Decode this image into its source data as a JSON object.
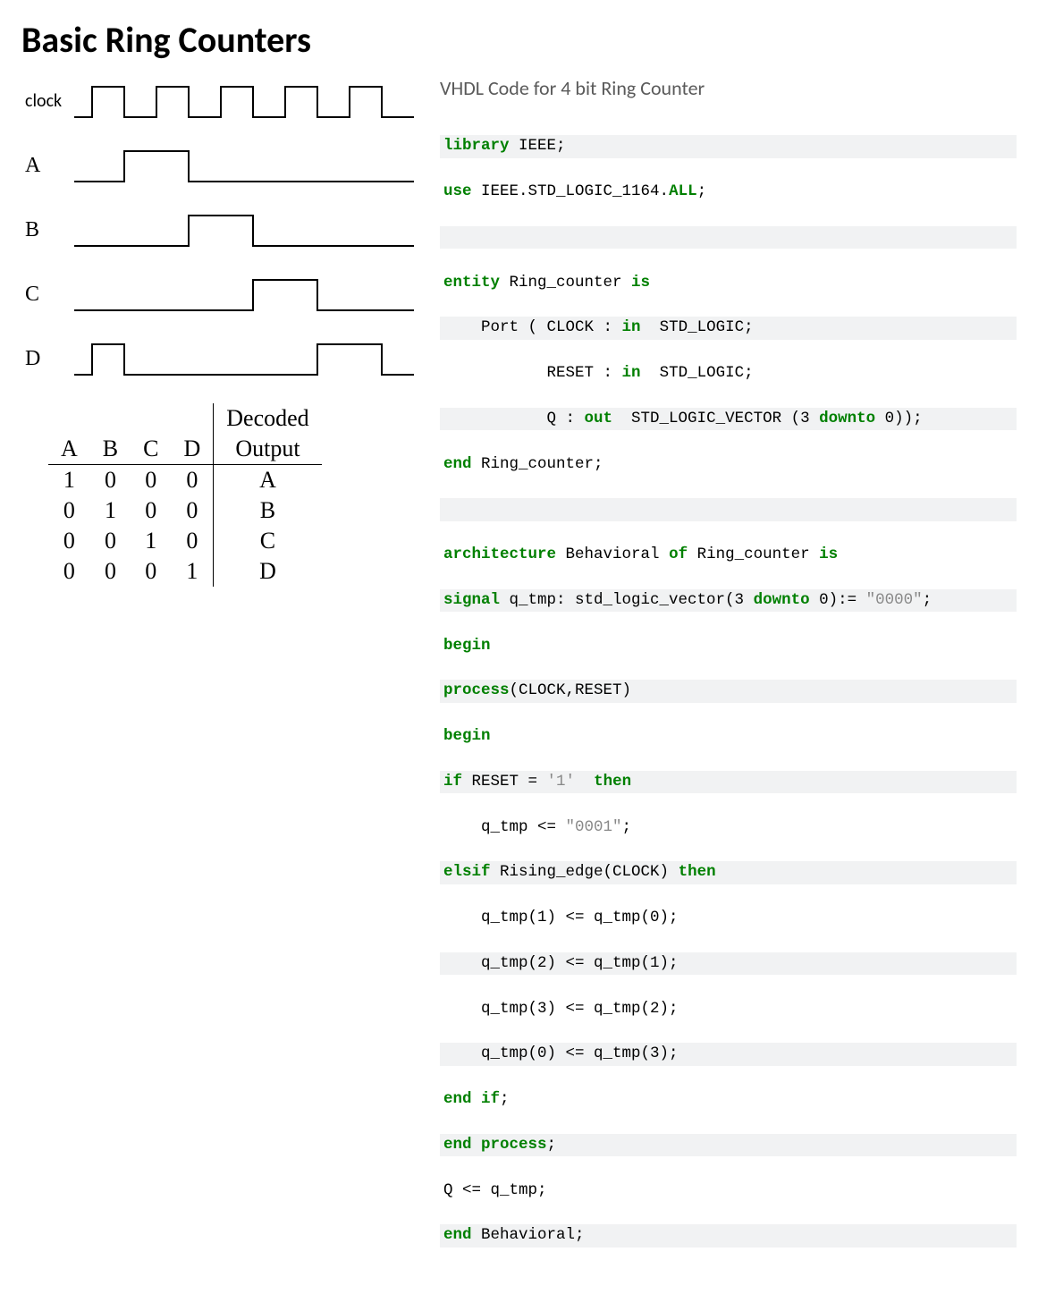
{
  "title": "Basic Ring Counters",
  "signals": {
    "clock_label": "clock",
    "a_label": "A",
    "b_label": "B",
    "c_label": "C",
    "d_label": "D"
  },
  "table": {
    "col_a": "A",
    "col_b": "B",
    "col_c": "C",
    "col_d": "D",
    "col_decoded1": "Decoded",
    "col_decoded2": "Output",
    "rows": [
      {
        "a": "1",
        "b": "0",
        "c": "0",
        "d": "0",
        "out": "A"
      },
      {
        "a": "0",
        "b": "1",
        "c": "0",
        "d": "0",
        "out": "B"
      },
      {
        "a": "0",
        "b": "0",
        "c": "1",
        "d": "0",
        "out": "C"
      },
      {
        "a": "0",
        "b": "0",
        "c": "0",
        "d": "1",
        "out": "D"
      }
    ]
  },
  "code_title": "VHDL Code for 4 bit Ring Counter",
  "code": {
    "l1a": "library",
    "l1b": " IEEE;",
    "l2a": "use",
    "l2b": " IEEE.STD_LOGIC_1164.",
    "l2c": "ALL",
    "l2d": ";",
    "l4a": "entity",
    "l4b": " Ring_counter ",
    "l4c": "is",
    "l5a": "    Port ( CLOCK : ",
    "l5b": "in",
    "l5c": "  STD_LOGIC;",
    "l6a": "           RESET : ",
    "l6b": "in",
    "l6c": "  STD_LOGIC;",
    "l7a": "           Q : ",
    "l7b": "out",
    "l7c": "  STD_LOGIC_VECTOR (3 ",
    "l7d": "downto",
    "l7e": " 0));",
    "l8a": "end",
    "l8b": " Ring_counter;",
    "l10a": "architecture",
    "l10b": " Behavioral ",
    "l10c": "of",
    "l10d": " Ring_counter ",
    "l10e": "is",
    "l11a": "signal",
    "l11b": " q_tmp: std_logic_vector(3 ",
    "l11c": "downto",
    "l11d": " 0):= ",
    "l11e": "\"0000\"",
    "l11f": ";",
    "l12": "begin",
    "l13a": "process",
    "l13b": "(CLOCK,RESET)",
    "l14": "begin",
    "l15a": "if",
    "l15b": " RESET = ",
    "l15c": "'1'",
    "l15d": "  ",
    "l15e": "then",
    "l16a": "    q_tmp <= ",
    "l16b": "\"0001\"",
    "l16c": ";",
    "l17a": "elsif",
    "l17b": " Rising_edge(CLOCK) ",
    "l17c": "then",
    "l18": "    q_tmp(1) <= q_tmp(0);",
    "l19": "    q_tmp(2) <= q_tmp(1);",
    "l20": "    q_tmp(3) <= q_tmp(2);",
    "l21": "    q_tmp(0) <= q_tmp(3);",
    "l22a": "end",
    "l22b": " ",
    "l22c": "if",
    "l22d": ";",
    "l23a": "end",
    "l23b": " ",
    "l23c": "process",
    "l23d": ";",
    "l24": "Q <= q_tmp;",
    "l25a": "end",
    "l25b": " Behavioral;"
  },
  "chart_data": {
    "type": "table",
    "description": "4-bit ring counter timing diagram and truth table",
    "signals": [
      "clock",
      "A",
      "B",
      "C",
      "D"
    ],
    "clock_cycles": 5,
    "states": [
      {
        "A": 1,
        "B": 0,
        "C": 0,
        "D": 0,
        "decoded": "A"
      },
      {
        "A": 0,
        "B": 1,
        "C": 0,
        "D": 0,
        "decoded": "B"
      },
      {
        "A": 0,
        "B": 0,
        "C": 1,
        "D": 0,
        "decoded": "C"
      },
      {
        "A": 0,
        "B": 0,
        "C": 0,
        "D": 1,
        "decoded": "D"
      }
    ]
  }
}
